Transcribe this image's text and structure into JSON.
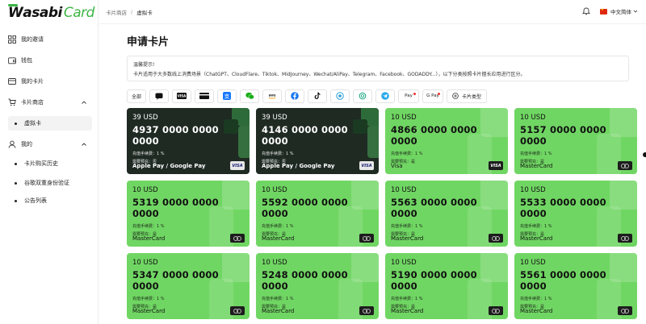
{
  "logo": {
    "w": "W",
    "rest": "asabi",
    "card": "Card"
  },
  "sidebar": {
    "items": [
      {
        "label": "我的邀请"
      },
      {
        "label": "钱包"
      },
      {
        "label": "我的卡片"
      },
      {
        "label": "卡片商店"
      },
      {
        "label": "虚拟卡"
      },
      {
        "label": "我的"
      },
      {
        "label": "卡片购买历史"
      },
      {
        "label": "谷歌双重身份验证"
      },
      {
        "label": "公告列表"
      }
    ]
  },
  "header": {
    "breadcrumb": [
      "卡片商店",
      "/",
      "虚拟卡"
    ],
    "language": "中文简体"
  },
  "main": {
    "title": "申请卡片",
    "notice": {
      "title": "温馨提示!",
      "text": "卡片适用于大多数线上消费场景（ChatGPT、CloudFlare、Tiktok、MidJourney、Wechat/AliPay、Telegram、Facebook、GODADDY...），以下分类按照卡片擅长应用进行区分。"
    },
    "filters": {
      "all": "全部",
      "more": "卡片类型",
      "apple_pay": "Pay",
      "google_pay": "G Pay"
    }
  },
  "cards": [
    {
      "amount": "39 USD",
      "number": "4937 0000 0000 0000",
      "fee": "充值手续费：1 %",
      "need": "需要预充：否",
      "brand": "Apple Pay   /   Google Pay",
      "network": "VISA",
      "theme": "dark"
    },
    {
      "amount": "39 USD",
      "number": "4146 0000 0000 0000",
      "fee": "充值手续费：1 %",
      "need": "需要预充：否",
      "brand": "Apple Pay   /   Google Pay",
      "network": "VISA",
      "theme": "dark"
    },
    {
      "amount": "10 USD",
      "number": "4866 0000 0000 0000",
      "fee": "充值手续费：1 %",
      "need": "需要预充：是",
      "brand": "Visa",
      "network": "VISA",
      "theme": "green"
    },
    {
      "amount": "10 USD",
      "number": "5157 0000 0000 0000",
      "fee": "充值手续费：1 %",
      "need": "需要预充：是",
      "brand": "MasterCard",
      "network": "MC",
      "theme": "green"
    },
    {
      "amount": "10 USD",
      "number": "5319 0000 0000 0000",
      "fee": "充值手续费：1 %",
      "need": "需要预充：是",
      "brand": "MasterCard",
      "network": "MC",
      "theme": "green"
    },
    {
      "amount": "10 USD",
      "number": "5592 0000 0000 0000",
      "fee": "充值手续费：1 %",
      "need": "需要预充：是",
      "brand": "MasterCard",
      "network": "MC",
      "theme": "green"
    },
    {
      "amount": "10 USD",
      "number": "5563 0000 0000 0000",
      "fee": "充值手续费：1 %",
      "need": "需要预充：是",
      "brand": "MasterCard",
      "network": "MC",
      "theme": "green"
    },
    {
      "amount": "10 USD",
      "number": "5533 0000 0000 0000",
      "fee": "充值手续费：1 %",
      "need": "需要预充：是",
      "brand": "MasterCard",
      "network": "MC",
      "theme": "green"
    },
    {
      "amount": "10 USD",
      "number": "5347 0000 0000 0000",
      "fee": "充值手续费：1 %",
      "need": "需要预充：是",
      "brand": "MasterCard",
      "network": "MC",
      "theme": "green"
    },
    {
      "amount": "10 USD",
      "number": "5248 0000 0000 0000",
      "fee": "充值手续费：1 %",
      "need": "需要预充：是",
      "brand": "MasterCard",
      "network": "MC",
      "theme": "green"
    },
    {
      "amount": "10 USD",
      "number": "5190 0000 0000 0000",
      "fee": "充值手续费：1 %",
      "need": "需要预充：是",
      "brand": "MasterCard",
      "network": "MC",
      "theme": "green"
    },
    {
      "amount": "10 USD",
      "number": "5561 0000 0000 0000",
      "fee": "充值手续费：1 %",
      "need": "需要预充：是",
      "brand": "MasterCard",
      "network": "MC",
      "theme": "green"
    }
  ],
  "colors": {
    "accent": "#70d663",
    "dark_card": "#1f2a23",
    "logo_green": "#3cb445"
  }
}
